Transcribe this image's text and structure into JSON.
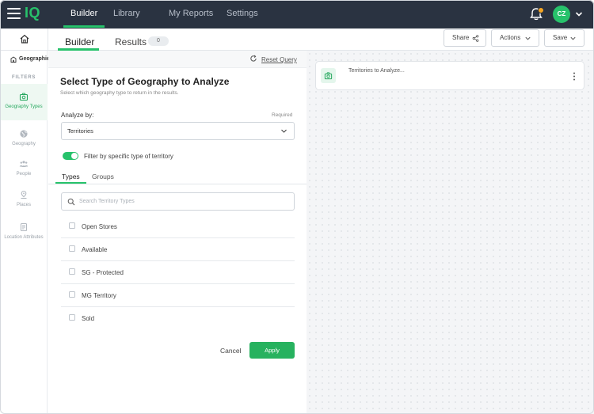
{
  "app": {
    "logo": "IQ",
    "nav": [
      "Builder",
      "Library",
      "My Reports",
      "Settings"
    ],
    "user_initials": "CZ"
  },
  "subbar": {
    "tabs": [
      {
        "label": "Builder"
      },
      {
        "label": "Results",
        "badge": "0"
      }
    ],
    "share_label": "Share",
    "actions_label": "Actions",
    "save_label": "Save"
  },
  "rail": {
    "header_label": "Geographies",
    "filters_label": "FILTERS",
    "items": [
      {
        "label": "Geography Types",
        "icon": "geography-types-icon"
      },
      {
        "label": "Geography",
        "icon": "globe-icon"
      },
      {
        "label": "People",
        "icon": "people-icon"
      },
      {
        "label": "Places",
        "icon": "place-pin-icon"
      },
      {
        "label": "Location Attributes",
        "icon": "location-attributes-icon"
      }
    ]
  },
  "panel": {
    "reset_label": "Reset Query",
    "title": "Select Type of Geography to Analyze",
    "subtitle": "Select which geography type to return in the results.",
    "analyze_label": "Analyze by:",
    "required_label": "Required",
    "analyze_value": "Territories",
    "toggle_on": true,
    "toggle_label": "Filter by specific type of territory",
    "tabs": [
      "Types",
      "Groups"
    ],
    "search_placeholder": "Search Territory Types",
    "types": [
      {
        "label": "Open Stores",
        "checked": false
      },
      {
        "label": "Available",
        "checked": false
      },
      {
        "label": "SG - Protected",
        "checked": false
      },
      {
        "label": "MG Territory",
        "checked": false
      },
      {
        "label": "Sold",
        "checked": false
      }
    ],
    "cancel_label": "Cancel",
    "apply_label": "Apply"
  },
  "canvas": {
    "card_title": "Territories to Analyze..."
  },
  "colors": {
    "accent": "#27c26b",
    "topbar": "#2a3341",
    "apply": "#27b25f",
    "badge": "#f5a623"
  }
}
